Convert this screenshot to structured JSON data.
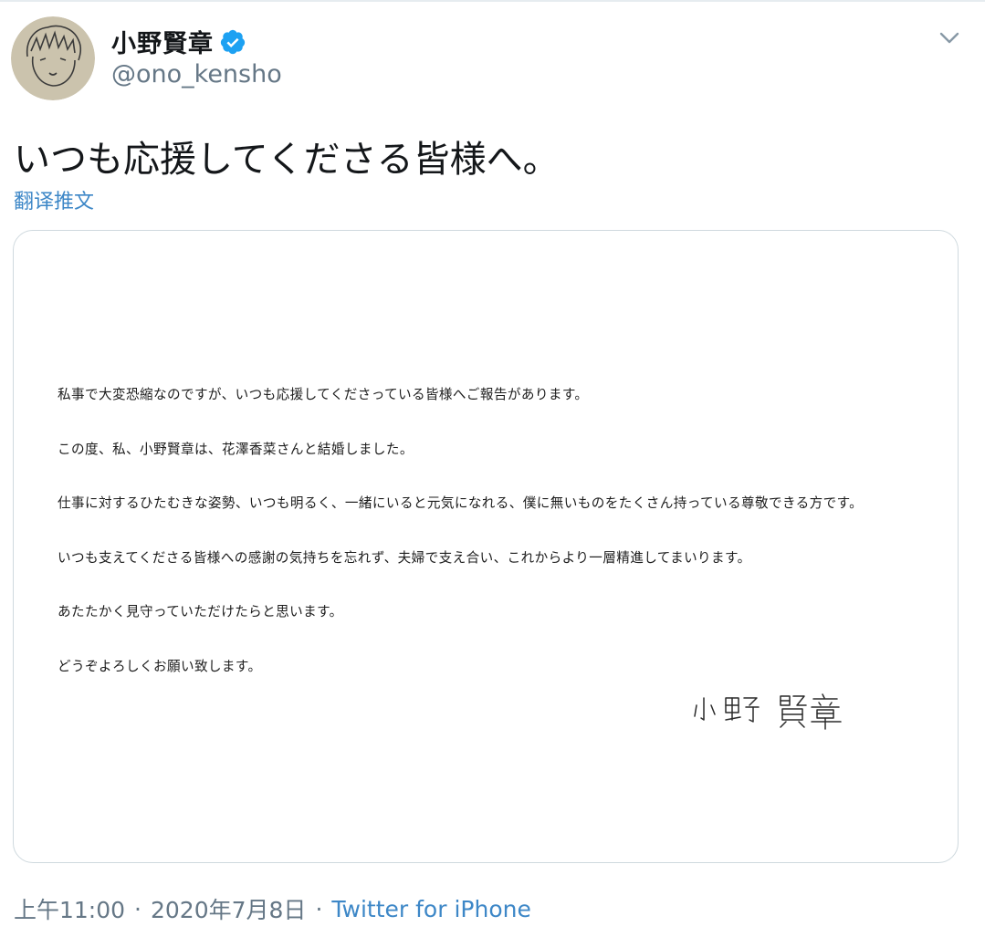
{
  "tweet": {
    "author": {
      "display_name": "小野賢章",
      "handle": "@ono_kensho",
      "verified": true
    },
    "text": "いつも応援してくださる皆様へ。",
    "translate_label": "翻译推文",
    "media": {
      "letter": {
        "paragraphs": [
          "私事で大変恐縮なのですが、いつも応援してくださっている皆様へご報告があります。",
          "この度、私、小野賢章は、花澤香菜さんと結婚しました。",
          "仕事に対するひたむきな姿勢、いつも明るく、一緒にいると元気になれる、僕に無いものをたくさん持っている尊敬できる方です。",
          "いつも支えてくださる皆様への感謝の気持ちを忘れず、夫婦で支え合い、これからより一層精進してまいります。",
          "あたたかく見守っていただけたらと思います。",
          "どうぞよろしくお願い致します。"
        ],
        "signature": "小野 賢章"
      }
    },
    "footer": {
      "time": "上午11:00",
      "separator": "·",
      "date": "2020年7月8日",
      "source": "Twitter for iPhone"
    }
  },
  "colors": {
    "link": "#3d87c7",
    "secondary_text": "#657786",
    "verified_badge": "#1da1f2"
  },
  "icons": {
    "verified": "verified-badge-icon",
    "more": "chevron-down-icon"
  }
}
